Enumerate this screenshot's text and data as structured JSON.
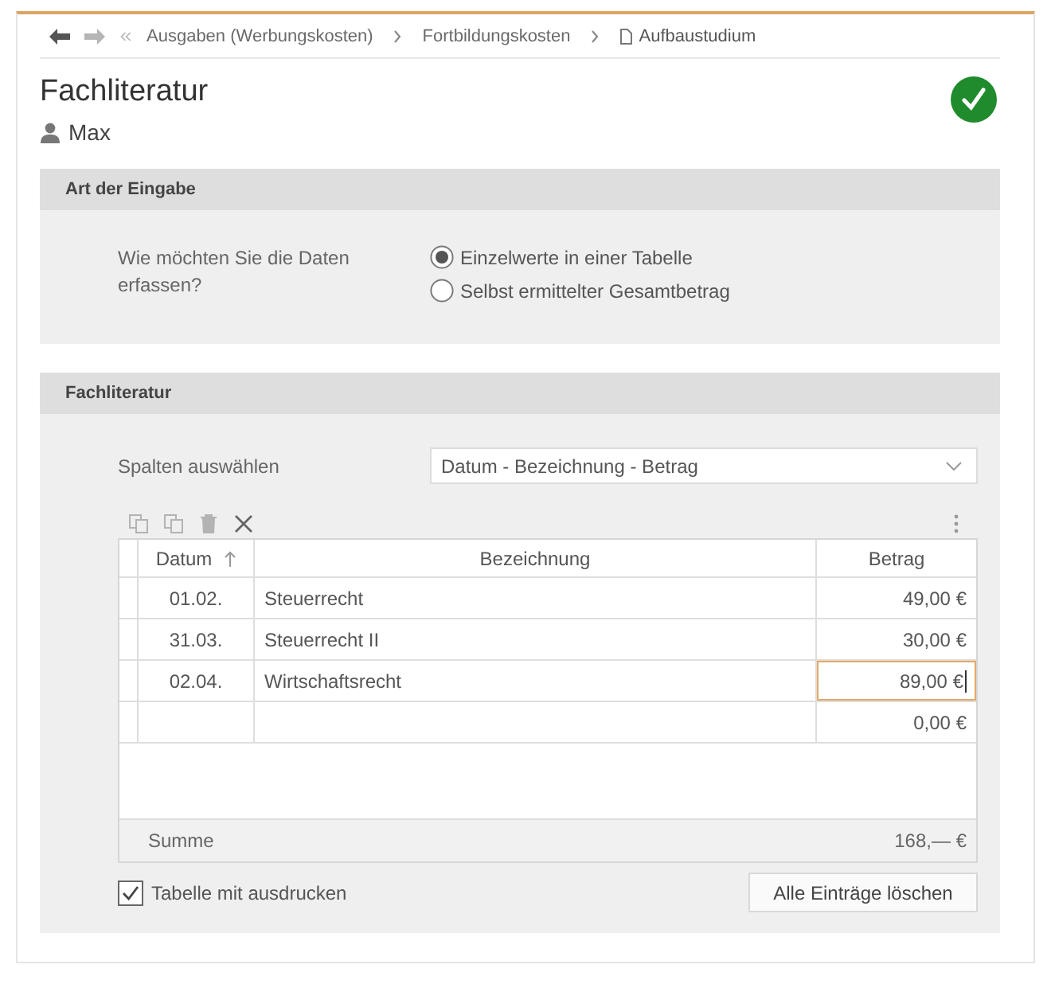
{
  "navigation": {
    "buttons": [
      {
        "kind": "back",
        "disabled": false
      },
      {
        "kind": "forward",
        "disabled": true
      },
      {
        "kind": "first",
        "disabled": true
      }
    ],
    "breadcrumb": [
      {
        "kind": "link",
        "label": "Ausgaben (Werbungskosten)"
      },
      {
        "kind": "link",
        "label": "Fortbildungskosten"
      },
      {
        "kind": "current",
        "label": "Aufbaustudium"
      }
    ]
  },
  "header": {
    "title": "Fachliteratur",
    "person": "Max",
    "complete": true
  },
  "input_mode": {
    "title": "Art der Eingabe",
    "question": "Wie möchten Sie die Daten erfassen?",
    "options": [
      {
        "label": "Einzelwerte in einer Tabelle",
        "selected": true
      },
      {
        "label": "Selbst ermittelter Gesamtbetrag",
        "selected": false
      }
    ]
  },
  "literature": {
    "title": "Fachliteratur",
    "columns_label": "Spalten auswählen",
    "columns_value": "Datum - Bezeichnung - Betrag",
    "toolbar": [
      {
        "kind": "copy",
        "disabled": true
      },
      {
        "kind": "copy",
        "disabled": true
      },
      {
        "kind": "trash",
        "disabled": true
      },
      {
        "kind": "cross",
        "disabled": false
      }
    ],
    "table": {
      "columns": [
        {
          "label": "Datum",
          "sorted": true
        },
        {
          "label": "Bezeichnung",
          "sorted": false
        },
        {
          "label": "Betrag",
          "sorted": false
        }
      ],
      "rows": [
        {
          "date": "01.02.",
          "description": "Steuerrecht",
          "amount": "49,00 €",
          "editing": false
        },
        {
          "date": "31.03.",
          "description": "Steuerrecht II",
          "amount": "30,00 €",
          "editing": false
        },
        {
          "date": "02.04.",
          "description": "Wirtschaftsrecht",
          "amount": "89,00 €",
          "editing": true
        },
        {
          "amount": "0,00 €",
          "editing": false
        }
      ],
      "total_label": "Summe",
      "total": "168,— €"
    },
    "print_table": {
      "label": "Tabelle mit ausdrucken",
      "checked": true
    },
    "clear_button": "Alle Einträge löschen"
  }
}
